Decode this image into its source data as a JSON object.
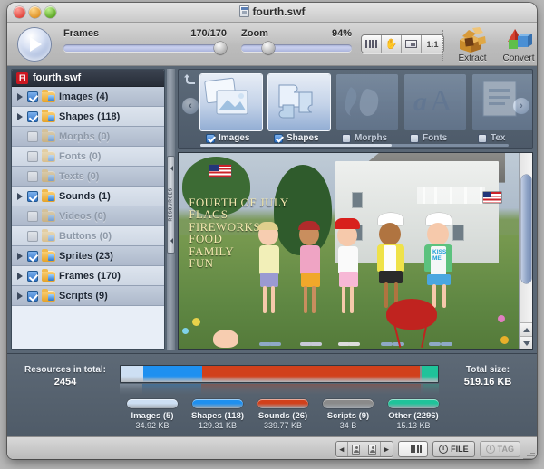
{
  "window": {
    "title": "fourth.swf",
    "title_icon": "swf-file-icon",
    "buttons": {
      "close": "close-button",
      "minimize": "minimize-button",
      "zoom": "zoom-button"
    }
  },
  "toolbar": {
    "play_label": "play-button",
    "frames": {
      "label": "Frames",
      "value": "170/170",
      "position_percent": 100
    },
    "zoom": {
      "label": "Zoom",
      "value": "94%",
      "position_percent": 19
    },
    "view_modes": [
      {
        "name": "timeline-view",
        "icon": "bars-icon"
      },
      {
        "name": "hand-tool",
        "icon": "hand-icon"
      },
      {
        "name": "fit-window",
        "icon": "fit-window-icon"
      },
      {
        "name": "actual-size",
        "label": "1:1"
      }
    ],
    "actions": [
      {
        "label": "Extract",
        "icon": "extract-icon"
      },
      {
        "label": "Convert",
        "icon": "convert-icon"
      }
    ]
  },
  "sidebar": {
    "header": {
      "badge": "Fl",
      "title": "fourth.swf"
    },
    "splitter_label": "RESOURCES",
    "items": [
      {
        "label": "Images (4)",
        "checked": true,
        "enabled": true,
        "expandable": true
      },
      {
        "label": "Shapes (118)",
        "checked": true,
        "enabled": true,
        "expandable": true
      },
      {
        "label": "Morphs (0)",
        "checked": false,
        "enabled": false,
        "expandable": false
      },
      {
        "label": "Fonts (0)",
        "checked": false,
        "enabled": false,
        "expandable": false
      },
      {
        "label": "Texts (0)",
        "checked": false,
        "enabled": false,
        "expandable": false
      },
      {
        "label": "Sounds (1)",
        "checked": true,
        "enabled": true,
        "expandable": true
      },
      {
        "label": "Videos (0)",
        "checked": false,
        "enabled": false,
        "expandable": false
      },
      {
        "label": "Buttons (0)",
        "checked": false,
        "enabled": false,
        "expandable": false
      },
      {
        "label": "Sprites (23)",
        "checked": true,
        "enabled": true,
        "expandable": true
      },
      {
        "label": "Frames (170)",
        "checked": true,
        "enabled": true,
        "expandable": true
      },
      {
        "label": "Scripts (9)",
        "checked": true,
        "enabled": true,
        "expandable": true
      }
    ]
  },
  "carousel": {
    "undo_icon": "undo-arrow-icon",
    "prev_label": "‹",
    "next_label": "›",
    "tabs": [
      {
        "label": "Images",
        "checked": true,
        "selected": true,
        "icon": "photos-icon"
      },
      {
        "label": "Shapes",
        "checked": true,
        "selected": true,
        "icon": "puzzle-icon"
      },
      {
        "label": "Morphs",
        "checked": false,
        "selected": false,
        "icon": "morph-icon"
      },
      {
        "label": "Fonts",
        "checked": false,
        "selected": false,
        "icon": "font-aA-icon"
      },
      {
        "label": "Tex",
        "checked": false,
        "selected": false,
        "icon": "text-icon"
      }
    ]
  },
  "preview": {
    "name": "swf-stage-preview",
    "overlay_lines": [
      "FOURTH OF JULY",
      "FLAGS",
      "FIREWORKS",
      "FOOD",
      "FAMILY",
      "FUN"
    ],
    "apron_text": [
      "KISS",
      "ME"
    ]
  },
  "stats": {
    "total_label": "Resources in total:",
    "total_value": "2454",
    "size_label": "Total size:",
    "size_value": "519.16 KB"
  },
  "chart_data": {
    "type": "bar",
    "title": "Resource size distribution",
    "orientation": "horizontal-stacked",
    "categories": [
      "Images (5)",
      "Shapes (118)",
      "Sounds (26)",
      "Scripts (9)",
      "Other (2296)"
    ],
    "value_labels": [
      "34.92 KB",
      "129.31 KB",
      "339.77 KB",
      "34 B",
      "15.13 KB"
    ],
    "values_kb": [
      34.92,
      129.31,
      339.77,
      0.033,
      15.13
    ],
    "counts": [
      5,
      118,
      26,
      9,
      2296
    ],
    "colors": [
      "#cddff3",
      "#1e90f0",
      "#d1401b",
      "#8a8a8a",
      "#1fc39a"
    ],
    "total_kb": 519.16,
    "total_count": 2454,
    "legend_position": "below",
    "grid": false
  },
  "statusbar": {
    "nav_prev": "◂",
    "nav_next": "▸",
    "file_label": "FILE",
    "tag_label": "TAG",
    "info_glyph": "i"
  }
}
